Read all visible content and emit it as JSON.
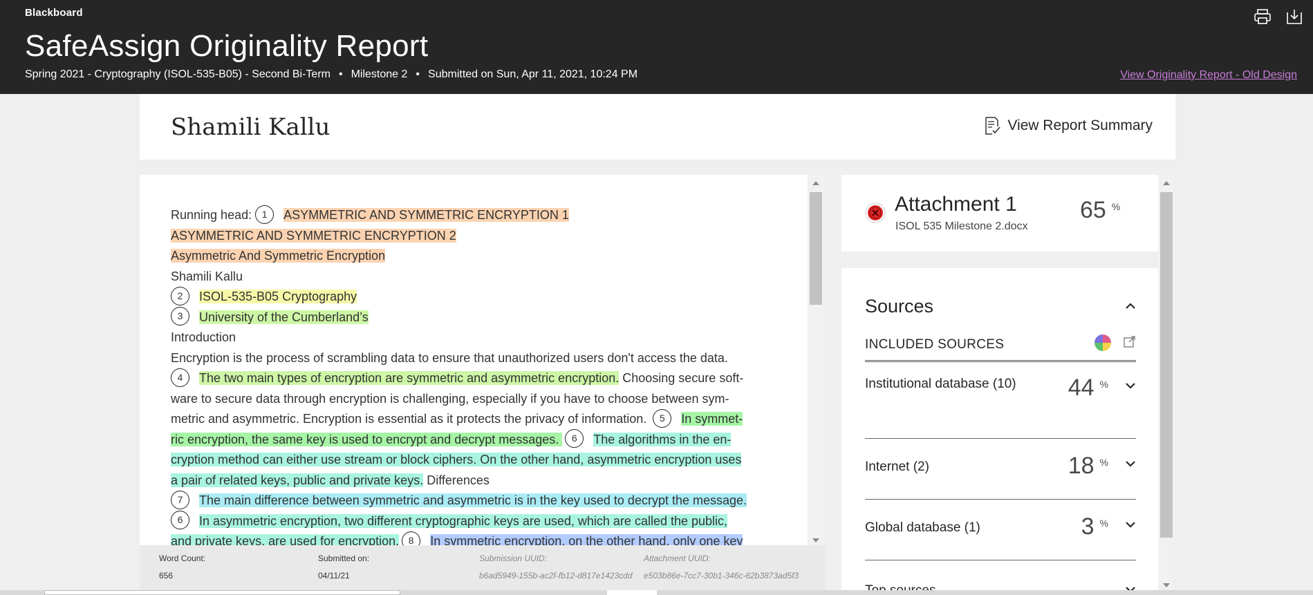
{
  "header": {
    "brand": "Blackboard",
    "title": "SafeAssign Originality Report",
    "course": "Spring 2021 - Cryptography (ISOL-535-B05) - Second Bi-Term",
    "assignment": "Milestone 2",
    "submitted": "Submitted on Sun, Apr 11, 2021, 10:24 PM",
    "separator": "•",
    "old_design_link": "View Originality Report - Old Design",
    "icons": [
      "print-icon",
      "download-icon"
    ]
  },
  "student": {
    "name": "Shamili Kallu",
    "summary_button": "View Report Summary"
  },
  "document": {
    "lines": [
      {
        "pre": "Running head: ",
        "num": "1",
        "hl": "ASYMMETRIC AND SYMMETRIC ENCRYPTION 1"
      },
      {
        "hl": "ASYMMETRIC AND SYMMETRIC ENCRYPTION 2"
      },
      {
        "hl": "Asymmetric And Symmetric Encryption"
      },
      {
        "text": "Shamili Kallu"
      },
      {
        "num": "2",
        "hl": "ISOL-535-B05 Cryptography"
      },
      {
        "num": "3",
        "hl": "University of the Cumberland’s"
      },
      {
        "text": "Introduction"
      },
      {
        "text": "Encryption is the process of scrambling data to ensure that unauthorized users don't access the data."
      },
      {
        "num": "4",
        "hl": "The two main types of encryption are symmetric and asymmetric encryption.",
        "post": " Choosing secure soft-"
      },
      {
        "text": "ware to secure data through encryption is challenging, especially if you have to choose between sym-"
      },
      {
        "text": "metric and asymmetric. Encryption is essential as it protects the privacy of information. ",
        "num": "5",
        "hl": "In symmet-"
      },
      {
        "hl": "ric encryption, the same key is used to encrypt and decrypt messages. ",
        "num": "6",
        "hl2": "The algorithms in the en-"
      },
      {
        "hl": "cryption method can either use stream or block ciphers. On the other hand, asymmetric encryption uses"
      },
      {
        "hl": "a pair of related keys, public and private keys.",
        "post": " Differences"
      },
      {
        "num": "7",
        "hl": "The main difference between symmetric and asymmetric is in the key used to decrypt the message."
      },
      {
        "num": "6",
        "hl": "In asymmetric encryption, two different cryptographic keys are used, which are called the public,"
      },
      {
        "hl": "and private keys, are used for encryption.",
        "num": "8",
        "hl2": "In symmetric encryption, on the other hand, only one key"
      }
    ]
  },
  "footer": {
    "word_count_label": "Word Count:",
    "word_count": "656",
    "submitted_label": "Submitted on:",
    "submitted_date": "04/11/21",
    "submission_uuid_label": "Submission UUID:",
    "submission_uuid": "b6ad5949-155b-ac2f-fb12-d817e1423cdd",
    "attachment_uuid_label": "Attachment UUID:",
    "attachment_uuid": "e503b86e-7cc7-30b1-346c-62b3873ad5f3"
  },
  "attachment": {
    "title": "Attachment 1",
    "file": "ISOL 535 Milestone 2.docx",
    "percent": "65",
    "percent_sign": "%"
  },
  "sources": {
    "title": "Sources",
    "included_label": "INCLUDED SOURCES",
    "items": [
      {
        "name": "Institutional database (10)",
        "percent": "44",
        "sign": "%"
      },
      {
        "name": "Internet (2)",
        "percent": "18",
        "sign": "%"
      },
      {
        "name": "Global database (1)",
        "percent": "3",
        "sign": "%"
      },
      {
        "name": "Top sources",
        "percent": "",
        "sign": ""
      }
    ]
  },
  "colors": {
    "header_bg": "#262626",
    "link": "#c77dd6",
    "hl_orange": "#fbd3b1",
    "hl_yellow": "#f6f8a8",
    "hl_green": "#a6f5a6",
    "hl_teal": "#a8f4e0",
    "hl_blue": "#a9ecf5",
    "hl_periwinkle": "#b2ccff",
    "error_red": "#e02424"
  }
}
